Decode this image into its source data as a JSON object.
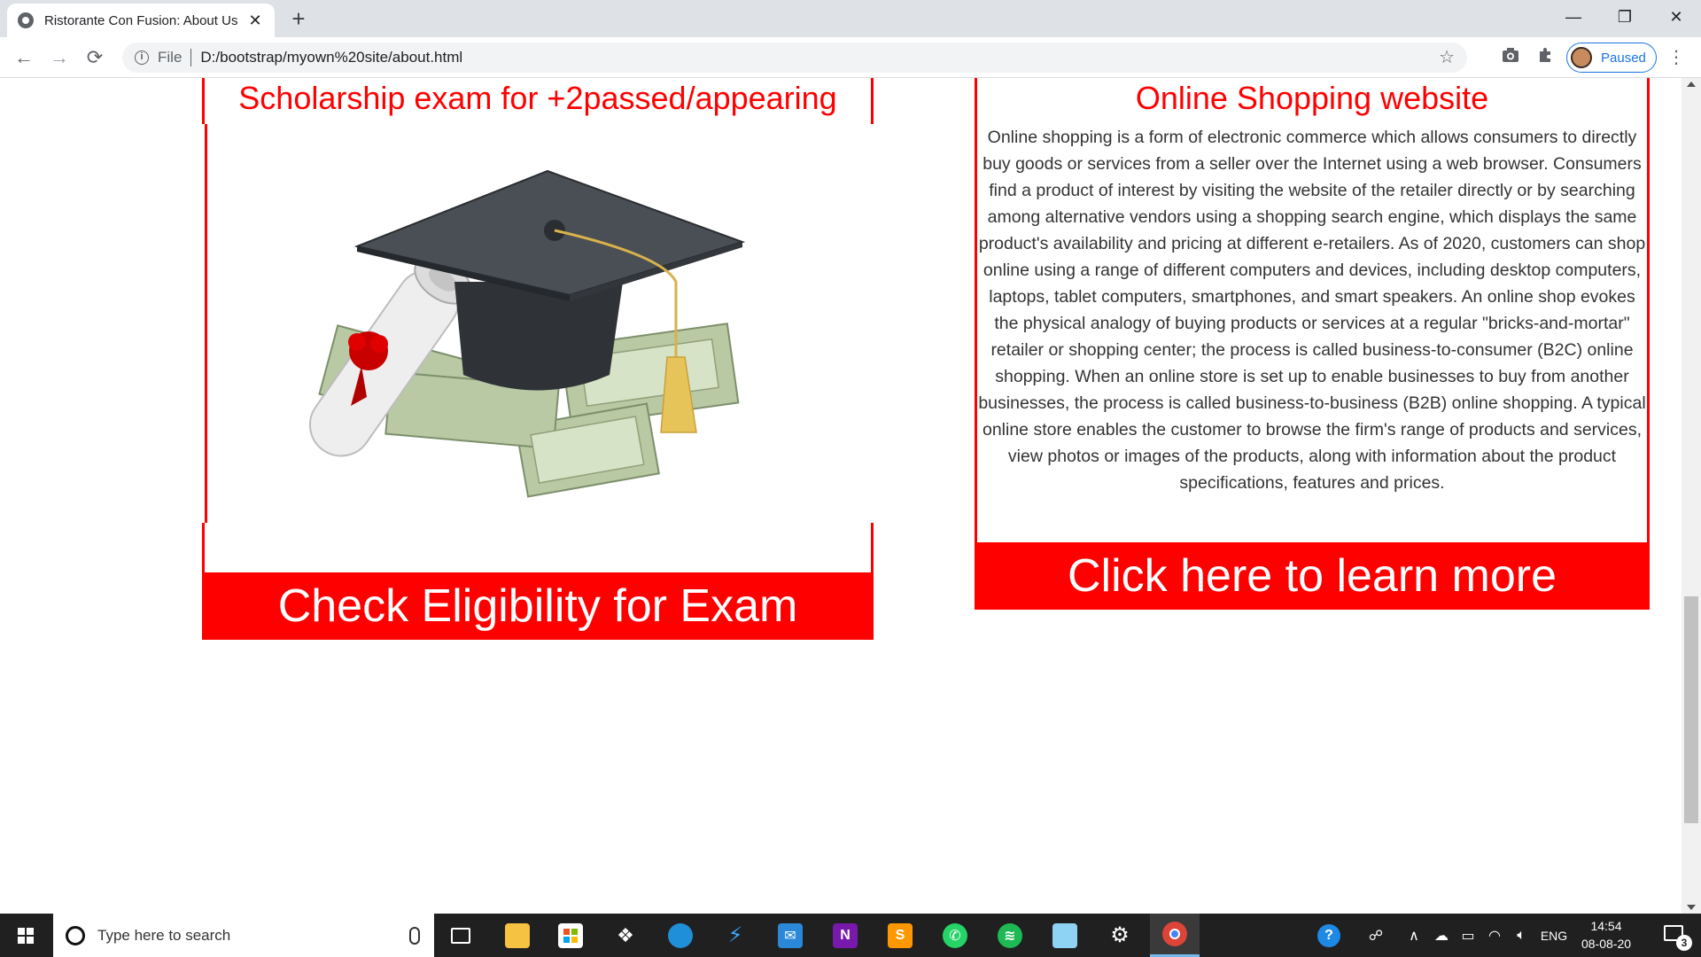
{
  "browser": {
    "tab_title": "Ristorante Con Fusion: About Us",
    "tab_close": "✕",
    "new_tab": "+",
    "url_scheme": "File",
    "url": "D:/bootstrap/myown%20site/about.html",
    "profile_status": "Paused",
    "window_controls": {
      "minimize": "—",
      "restore": "❐",
      "close": "✕"
    }
  },
  "page": {
    "left_card": {
      "title": "Scholarship exam for +2passed/appearing",
      "image_alt": "graduation-cap-diploma-money",
      "cta_label": "Check Eligibility for Exam"
    },
    "right_card": {
      "title": "Online Shopping website",
      "body": "Online shopping is a form of electronic commerce which allows consumers to directly buy goods or services from a seller over the Internet using a web browser. Consumers find a product of interest by visiting the website of the retailer directly or by searching among alternative vendors using a shopping search engine, which displays the same product's availability and pricing at different e-retailers. As of 2020, customers can shop online using a range of different computers and devices, including desktop computers, laptops, tablet computers, smartphones, and smart speakers. An online shop evokes the physical analogy of buying products or services at a regular \"bricks-and-mortar\" retailer or shopping center; the process is called business-to-consumer (B2C) online shopping. When an online store is set up to enable businesses to buy from another businesses, the process is called business-to-business (B2B) online shopping. A typical online store enables the customer to browse the firm's range of products and services, view photos or images of the products, along with information about the product specifications, features and prices.",
      "cta_label": "Click here to learn more"
    },
    "accent_color": "#ff0000"
  },
  "taskbar": {
    "search_placeholder": "Type here to search",
    "language": "ENG",
    "time": "14:54",
    "date": "08-08-20",
    "notification_count": "3",
    "apps": [
      "task-view",
      "file-explorer",
      "microsoft-store",
      "dropbox",
      "edge",
      "visual-studio",
      "mail",
      "onenote",
      "sublime-text",
      "whatsapp",
      "spotify",
      "notepad",
      "settings",
      "chrome"
    ]
  }
}
